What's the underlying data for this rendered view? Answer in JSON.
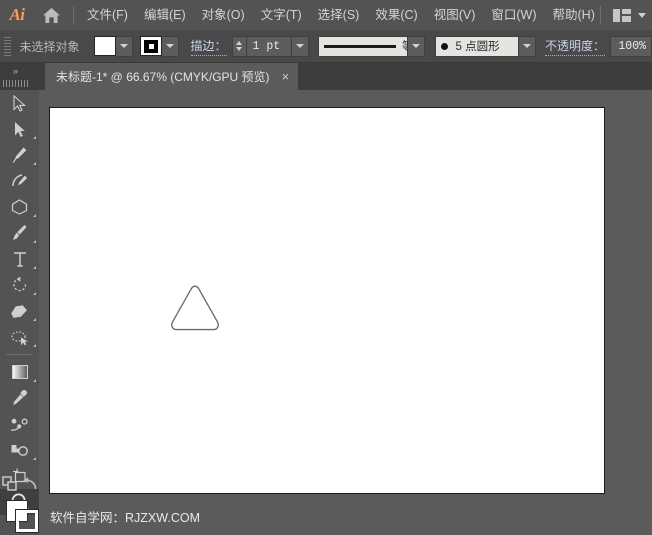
{
  "app": {
    "logo": "Ai",
    "home_icon": "home-icon",
    "workspace_icon": "workspace-switcher-icon",
    "workspace_chevron": "chevron-down-icon"
  },
  "menubar": {
    "items": [
      {
        "label": "文件(F)",
        "name": "menu-file"
      },
      {
        "label": "编辑(E)",
        "name": "menu-edit"
      },
      {
        "label": "对象(O)",
        "name": "menu-object"
      },
      {
        "label": "文字(T)",
        "name": "menu-type"
      },
      {
        "label": "选择(S)",
        "name": "menu-select"
      },
      {
        "label": "效果(C)",
        "name": "menu-effect"
      },
      {
        "label": "视图(V)",
        "name": "menu-view"
      },
      {
        "label": "窗口(W)",
        "name": "menu-window"
      },
      {
        "label": "帮助(H)",
        "name": "menu-help"
      }
    ]
  },
  "controlbar": {
    "selection_status": "未选择对象",
    "fill_color": "#ffffff",
    "stroke_color": "#000000",
    "stroke_label": "描边：",
    "stroke_weight": "1 pt",
    "stroke_profile": "等比",
    "brush_definition": "5 点圆形",
    "opacity_label": "不透明度：",
    "opacity_value": "100%"
  },
  "tabbar": {
    "document_title": "未标题-1* @ 66.67% (CMYK/GPU 预览)",
    "close_glyph": "×",
    "expand_glyph": "»"
  },
  "toolbar": {
    "tools": [
      {
        "name": "selection-tool",
        "icon": "selection-arrow-icon",
        "has_flyout": false,
        "active": false
      },
      {
        "name": "direct-selection-tool",
        "icon": "direct-selection-arrow-icon",
        "has_flyout": true,
        "active": false
      },
      {
        "name": "pen-tool",
        "icon": "pen-icon",
        "has_flyout": true,
        "active": false
      },
      {
        "name": "curvature-tool",
        "icon": "curvature-icon",
        "has_flyout": false,
        "active": false
      },
      {
        "name": "shape-tool",
        "icon": "polygon-icon",
        "has_flyout": true,
        "active": false
      },
      {
        "name": "paintbrush-tool",
        "icon": "paintbrush-icon",
        "has_flyout": true,
        "active": false
      },
      {
        "name": "type-tool",
        "icon": "type-t-icon",
        "has_flyout": true,
        "active": false
      },
      {
        "name": "rotate-tool",
        "icon": "rotate-icon",
        "has_flyout": true,
        "active": false
      },
      {
        "name": "eraser-tool",
        "icon": "eraser-icon",
        "has_flyout": true,
        "active": false
      },
      {
        "name": "shaper-tool",
        "icon": "shaper-lasso-icon",
        "has_flyout": true,
        "active": false
      },
      {
        "name": "gradient-tool",
        "icon": "gradient-icon",
        "has_flyout": true,
        "active": false
      },
      {
        "name": "eyedropper-tool",
        "icon": "eyedropper-icon",
        "has_flyout": false,
        "active": false
      },
      {
        "name": "blend-tool",
        "icon": "blend-icon",
        "has_flyout": false,
        "active": false
      },
      {
        "name": "shape-builder-tool",
        "icon": "shape-builder-icon",
        "has_flyout": true,
        "active": false
      },
      {
        "name": "artboard-tool",
        "icon": "artboard-icon",
        "has_flyout": false,
        "active": false
      },
      {
        "name": "zoom-tool",
        "icon": "magnifier-icon",
        "has_flyout": true,
        "active": true
      }
    ],
    "swap_icon": "swap-fill-stroke-icon",
    "default_icon": "default-fill-stroke-icon",
    "fill_swatch_color": "#ffffff",
    "stroke_swatch_color": "#ffffff"
  },
  "canvas": {
    "artboard_bg": "#ffffff",
    "shape": {
      "name": "rounded-triangle",
      "stroke_color": "#6e6e6e",
      "fill": "none",
      "stroke_width": 1.3
    },
    "watermark": "软件自学网：RJZXW.COM"
  }
}
